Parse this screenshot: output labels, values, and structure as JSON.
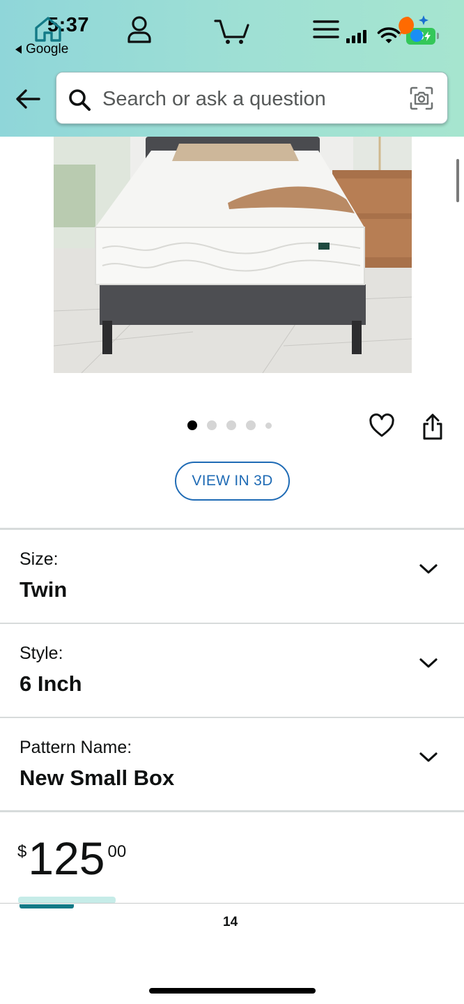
{
  "status_bar": {
    "time": "5:37",
    "back_app": "Google",
    "battery": "58"
  },
  "search": {
    "placeholder": "Search or ask a question"
  },
  "gallery": {
    "image_count": 5,
    "active_index": 0
  },
  "view_3d_label": "VIEW IN 3D",
  "options": [
    {
      "label": "Size:",
      "value": "Twin"
    },
    {
      "label": "Style:",
      "value": "6 Inch"
    },
    {
      "label": "Pattern Name:",
      "value": "New Small Box"
    }
  ],
  "price": {
    "currency": "$",
    "whole": "125",
    "fraction": "00"
  },
  "bottom_nav": {
    "cart_count": "14",
    "items": [
      "home-icon",
      "account-icon",
      "cart-icon",
      "menu-icon",
      "rufus-icon"
    ]
  },
  "colors": {
    "accent": "#1f6bb5",
    "home_active": "#137a87",
    "header_start": "#8fd6d9",
    "header_end": "#a6e5cf",
    "battery": "#34c759"
  }
}
